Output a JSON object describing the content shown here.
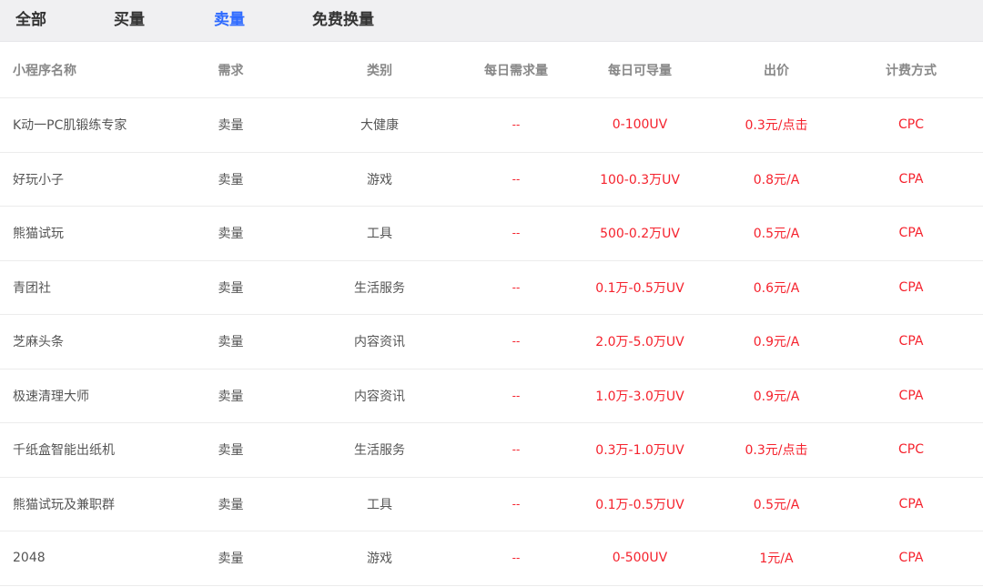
{
  "tabs": [
    {
      "label": "全部",
      "active": false
    },
    {
      "label": "买量",
      "active": false
    },
    {
      "label": "卖量",
      "active": true
    },
    {
      "label": "免费换量",
      "active": false
    }
  ],
  "columns": [
    "小程序名称",
    "需求",
    "类别",
    "每日需求量",
    "每日可导量",
    "出价",
    "计费方式"
  ],
  "rows": [
    {
      "name": "K动一PC肌锻练专家",
      "demand": "卖量",
      "category": "大健康",
      "daily_demand": "--",
      "daily_supply": "0-100UV",
      "price": "0.3元/点击",
      "billing": "CPC"
    },
    {
      "name": "好玩小子",
      "demand": "卖量",
      "category": "游戏",
      "daily_demand": "--",
      "daily_supply": "100-0.3万UV",
      "price": "0.8元/A",
      "billing": "CPA"
    },
    {
      "name": "熊猫试玩",
      "demand": "卖量",
      "category": "工具",
      "daily_demand": "--",
      "daily_supply": "500-0.2万UV",
      "price": "0.5元/A",
      "billing": "CPA"
    },
    {
      "name": "青团社",
      "demand": "卖量",
      "category": "生活服务",
      "daily_demand": "--",
      "daily_supply": "0.1万-0.5万UV",
      "price": "0.6元/A",
      "billing": "CPA"
    },
    {
      "name": "芝麻头条",
      "demand": "卖量",
      "category": "内容资讯",
      "daily_demand": "--",
      "daily_supply": "2.0万-5.0万UV",
      "price": "0.9元/A",
      "billing": "CPA"
    },
    {
      "name": "极速清理大师",
      "demand": "卖量",
      "category": "内容资讯",
      "daily_demand": "--",
      "daily_supply": "1.0万-3.0万UV",
      "price": "0.9元/A",
      "billing": "CPA"
    },
    {
      "name": "千纸盒智能出纸机",
      "demand": "卖量",
      "category": "生活服务",
      "daily_demand": "--",
      "daily_supply": "0.3万-1.0万UV",
      "price": "0.3元/点击",
      "billing": "CPC"
    },
    {
      "name": "熊猫试玩及兼职群",
      "demand": "卖量",
      "category": "工具",
      "daily_demand": "--",
      "daily_supply": "0.1万-0.5万UV",
      "price": "0.5元/A",
      "billing": "CPA"
    },
    {
      "name": "2048",
      "demand": "卖量",
      "category": "游戏",
      "daily_demand": "--",
      "daily_supply": "0-500UV",
      "price": "1元/A",
      "billing": "CPA"
    }
  ],
  "colors": {
    "accent": "#2f6bff",
    "value_red": "#f5222d",
    "tab_bar_bg": "#f0f0f2"
  }
}
